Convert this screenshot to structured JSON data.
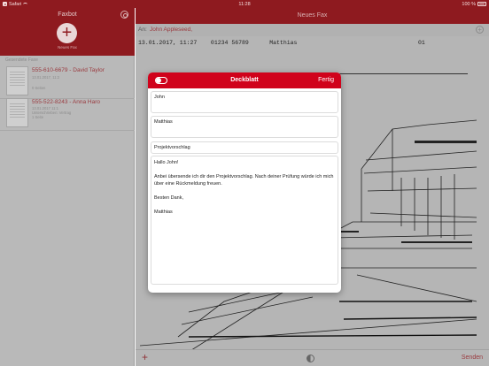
{
  "status_bar": {
    "back_label": "Safari",
    "time": "11:28",
    "battery_text": "100 %"
  },
  "sidebar": {
    "title": "Faxbot",
    "new_fax_label": "Neues Fax",
    "section_label": "Gesendete Faxe",
    "items": [
      {
        "title": "555-610-6679 - David Taylor",
        "lines": [
          "13.01.2017, 11:2",
          "",
          "0 Seiten"
        ]
      },
      {
        "title": "555-522-8243 - Anna Haro",
        "lines": [
          "13.01.2017 11:1",
          "Unterschrieben: Vertrag",
          "1 Seite"
        ]
      }
    ]
  },
  "main": {
    "title": "Neues Fax",
    "recipient_label": "An:",
    "recipient_name": "John Appleseed,",
    "fax_header": "13.01.2017, 11:27    01234 56789      Matthias                                   01"
  },
  "modal": {
    "title": "Deckblatt",
    "done_label": "Fertig",
    "toggle_on": false,
    "to_field": "John",
    "from_field": "Matthias",
    "subject_field": "Projektvorschlag",
    "body_lines": [
      "Hallo John!",
      "",
      "Anbei übersende ich dir den Projektvorschlag. Nach deiner Prüfung würde ich mich über eine Rückmeldung freuen.",
      "",
      "Besten Dank,",
      "",
      "Matthias"
    ]
  },
  "bottom_bar": {
    "send_label": "Senden"
  },
  "colors": {
    "brand_dark": "#8e1a1f",
    "brand_red": "#d0021b",
    "link_red": "#9a3a3f"
  },
  "icons": {
    "back": "back-to-safari-icon",
    "wifi": "wifi-icon",
    "battery": "battery-icon",
    "settings": "gear-icon",
    "new_fax": "plus-icon",
    "add_recipient": "add-circle-icon",
    "add_page": "plus-icon",
    "contrast": "contrast-icon"
  }
}
